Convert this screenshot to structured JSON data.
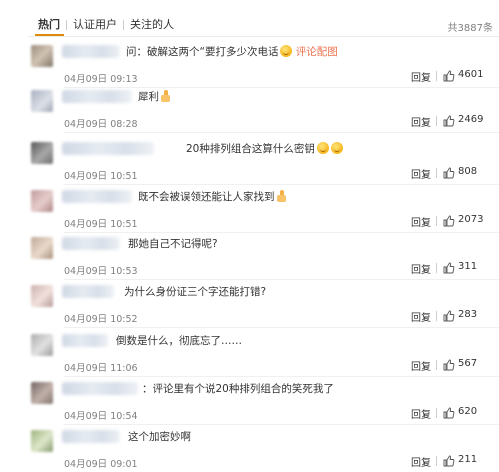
{
  "tabs": [
    {
      "label": "热门",
      "active": true
    },
    {
      "label": "认证用户",
      "active": false
    },
    {
      "label": "关注的人",
      "active": false
    }
  ],
  "total_count": "共3887条",
  "accent_color": "#e08a0a",
  "link_color": "#eb7350",
  "reply_label": "回复",
  "like_icon": "thumbs-up-icon",
  "comments": [
    {
      "text": "问：破解这两个“要打多少次电话",
      "emoji": "smile-emoji",
      "link": "评论配图",
      "time": "04月09日 09:13",
      "likes": "4601"
    },
    {
      "text": "犀利",
      "emoji": "thumbs-up-emoji",
      "time": "04月09日 08:28",
      "likes": "2469"
    },
    {
      "text": "20种排列组合这算什么密钥",
      "emoji": "laugh-cry-emoji",
      "time": "04月09日 10:51",
      "likes": "808"
    },
    {
      "text": "既不会被误领还能让人家找到",
      "emoji": "thumbs-up-emoji",
      "time": "04月09日 10:51",
      "likes": "2073"
    },
    {
      "text": "那她自己不记得呢?",
      "time": "04月09日 10:53",
      "likes": "311"
    },
    {
      "text": "为什么身份证三个字还能打错?",
      "time": "04月09日 10:52",
      "likes": "283"
    },
    {
      "text": "倒数是什么，彻底忘了……",
      "time": "04月09日 11:06",
      "likes": "567"
    },
    {
      "text": "：评论里有个说20种排列组合的笑死我了",
      "time": "04月09日 10:54",
      "likes": "620"
    },
    {
      "text": "这个加密妙啊",
      "time": "04月09日 09:01",
      "likes": "211"
    }
  ]
}
